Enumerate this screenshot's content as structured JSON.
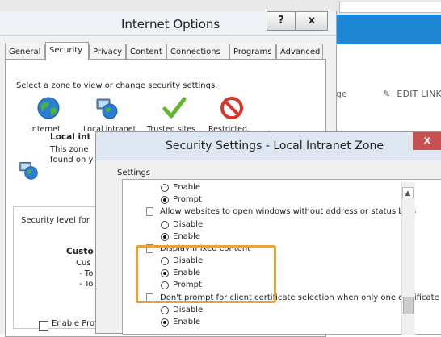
{
  "background_app": {
    "partial_label": "ge",
    "edit_links": "EDIT LINKS"
  },
  "internet_options": {
    "title": "Internet Options",
    "help_label": "?",
    "close_label": "x",
    "tabs": [
      "General",
      "Security",
      "Privacy",
      "Content",
      "Connections",
      "Programs",
      "Advanced"
    ],
    "active_tab": "Security",
    "zone_prompt": "Select a zone to view or change security settings.",
    "zones": [
      {
        "label": "Internet",
        "icon": "globe-icon"
      },
      {
        "label": "Local intranet",
        "icon": "intranet-icon"
      },
      {
        "label": "Trusted sites",
        "icon": "checkmark-icon"
      },
      {
        "label": "Restricted",
        "icon": "restricted-icon"
      }
    ],
    "zone_info": {
      "title": "Local int",
      "line1": "This zone",
      "line2": "found on y"
    },
    "security_level_label": "Security level for",
    "custom": {
      "title": "Custo",
      "line1": "Cus",
      "line2": "- To",
      "line3": "- To"
    },
    "enable_protected_label": "Enable Prot"
  },
  "security_settings": {
    "title": "Security Settings - Local Intranet Zone",
    "close_label": "x",
    "settings_label": "Settings",
    "options": {
      "enable_1": "Enable",
      "prompt_1": "Prompt",
      "allow_windows": "Allow websites to open windows without address or status bars",
      "disable_1": "Disable",
      "enable_2": "Enable",
      "mixed_content": "Display mixed content",
      "disable_2": "Disable",
      "enable_3": "Enable",
      "prompt_2": "Prompt",
      "dont_prompt": "Don't prompt for client certificate selection when only one certificate exists",
      "disable_3": "Disable",
      "enable_4": "Enable"
    }
  },
  "colors": {
    "highlight": "#e8a43a",
    "close_button": "#c75050",
    "accent_bar": "#1e87d5"
  }
}
